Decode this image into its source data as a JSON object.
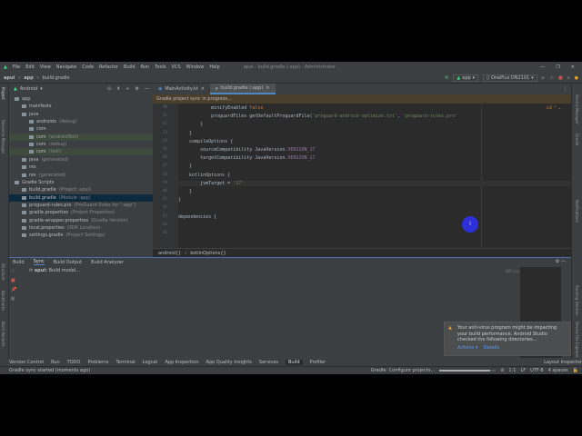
{
  "menu": [
    "File",
    "Edit",
    "View",
    "Navigate",
    "Code",
    "Refactor",
    "Build",
    "Run",
    "Tools",
    "VCS",
    "Window",
    "Help"
  ],
  "window_title": "apui - build.gradle (:app) - Administrator",
  "breadcrumb": [
    "apui",
    "app",
    "build.gradle"
  ],
  "toolbar": {
    "run_config": "app",
    "device": "OnePlus DN2101"
  },
  "project": {
    "view": "Android",
    "tree": [
      {
        "label": "app",
        "depth": 0
      },
      {
        "label": "manifests",
        "depth": 1
      },
      {
        "label": "java",
        "depth": 1
      },
      {
        "label": "androidx",
        "hint": "(debug)",
        "depth": 2
      },
      {
        "label": "com",
        "depth": 2
      },
      {
        "label": "com",
        "hint": "(androidTest)",
        "depth": 2,
        "hl": true
      },
      {
        "label": "com",
        "hint": "(debug)",
        "depth": 2
      },
      {
        "label": "com",
        "hint": "(test)",
        "depth": 2,
        "hl": true
      },
      {
        "label": "java",
        "hint": "(generated)",
        "depth": 1
      },
      {
        "label": "res",
        "depth": 1
      },
      {
        "label": "res",
        "hint": "(generated)",
        "depth": 1
      },
      {
        "label": "Gradle Scripts",
        "depth": 0
      },
      {
        "label": "build.gradle",
        "hint": "(Project: apui)",
        "depth": 1
      },
      {
        "label": "build.gradle",
        "hint": "(Module :app)",
        "depth": 1,
        "sel": true
      },
      {
        "label": "proguard-rules.pro",
        "hint": "(ProGuard Rules for \":app\")",
        "depth": 1
      },
      {
        "label": "gradle.properties",
        "hint": "(Project Properties)",
        "depth": 1
      },
      {
        "label": "gradle-wrapper.properties",
        "hint": "(Gradle Version)",
        "depth": 1
      },
      {
        "label": "local.properties",
        "hint": "(SDK Location)",
        "depth": 1
      },
      {
        "label": "settings.gradle",
        "hint": "(Project Settings)",
        "depth": 1
      }
    ]
  },
  "editor": {
    "tabs": [
      "MainActivity.kt",
      "build.gradle (:app)"
    ],
    "sync_banner": "Gradle project sync in progress...",
    "warnings": "3",
    "lines": [
      30,
      31,
      32,
      33,
      34,
      35,
      36,
      37,
      38,
      39,
      40,
      41,
      42,
      43,
      44,
      45
    ],
    "code": [
      [
        [
          "            minifyEnabled ",
          ""
        ],
        [
          "false",
          "kw"
        ]
      ],
      [
        [
          "            proguardFiles getDefaultProguardFile(",
          ""
        ],
        [
          "'proguard-android-optimize.txt'",
          "str"
        ],
        [
          ", ",
          ""
        ],
        [
          "'proguard-rules.pro'",
          "str"
        ]
      ],
      [
        [
          "        }",
          ""
        ]
      ],
      [
        [
          "    }",
          ""
        ]
      ],
      [
        [
          "    compileOptions {",
          ""
        ]
      ],
      [
        [
          "        sourceCompatibility JavaVersion.",
          ""
        ],
        [
          "VERSION_17",
          "cst"
        ]
      ],
      [
        [
          "        targetCompatibility JavaVersion.",
          ""
        ],
        [
          "VERSION_17",
          "cst"
        ]
      ],
      [
        [
          "    }",
          ""
        ]
      ],
      [
        [
          "    kotlinOptions {",
          ""
        ]
      ],
      [
        [
          "        jvmTarget = ",
          ""
        ],
        [
          "'17'",
          "str"
        ]
      ],
      [
        [
          "    }",
          ""
        ]
      ],
      [
        [
          "}",
          ""
        ]
      ],
      [
        [
          "",
          ""
        ]
      ],
      [
        [
          "dependencies {",
          ""
        ]
      ],
      [
        [
          "",
          ""
        ]
      ],
      [
        [
          "",
          ""
        ]
      ]
    ],
    "crumbs": [
      "android{}",
      "kotlinOptions{}"
    ]
  },
  "bottom": {
    "tabs": [
      "Build",
      "Sync",
      "Build Output",
      "Build Analyzer"
    ],
    "task": "apui:",
    "task_msg": "Build model...",
    "time": "987 ms"
  },
  "left_strip": [
    "Project",
    "Resource Manager",
    "Structure",
    "Bookmarks",
    "Build Variants"
  ],
  "right_strip": [
    "Device Manager",
    "Gradle",
    "Notifications",
    "Running Devices",
    "Device File Explorer"
  ],
  "tool_windows": [
    "Version Control",
    "Run",
    "TODO",
    "Problems",
    "Terminal",
    "Logcat",
    "App Inspection",
    "App Quality Insights",
    "Services",
    "Build",
    "Profiler",
    "Layout Inspector"
  ],
  "notification": {
    "text": "Your anti-virus program might be impacting your build performance. Android Studio checked the following directories...",
    "actions": "Actions",
    "details": "Details"
  },
  "status": {
    "message": "Gradle sync started (moments ago)",
    "task": "Gradle: Configure projects...",
    "progress": 0.9,
    "pos": "1:1",
    "eol": "LF",
    "enc": "UTF-8",
    "indent": "4 spaces"
  }
}
